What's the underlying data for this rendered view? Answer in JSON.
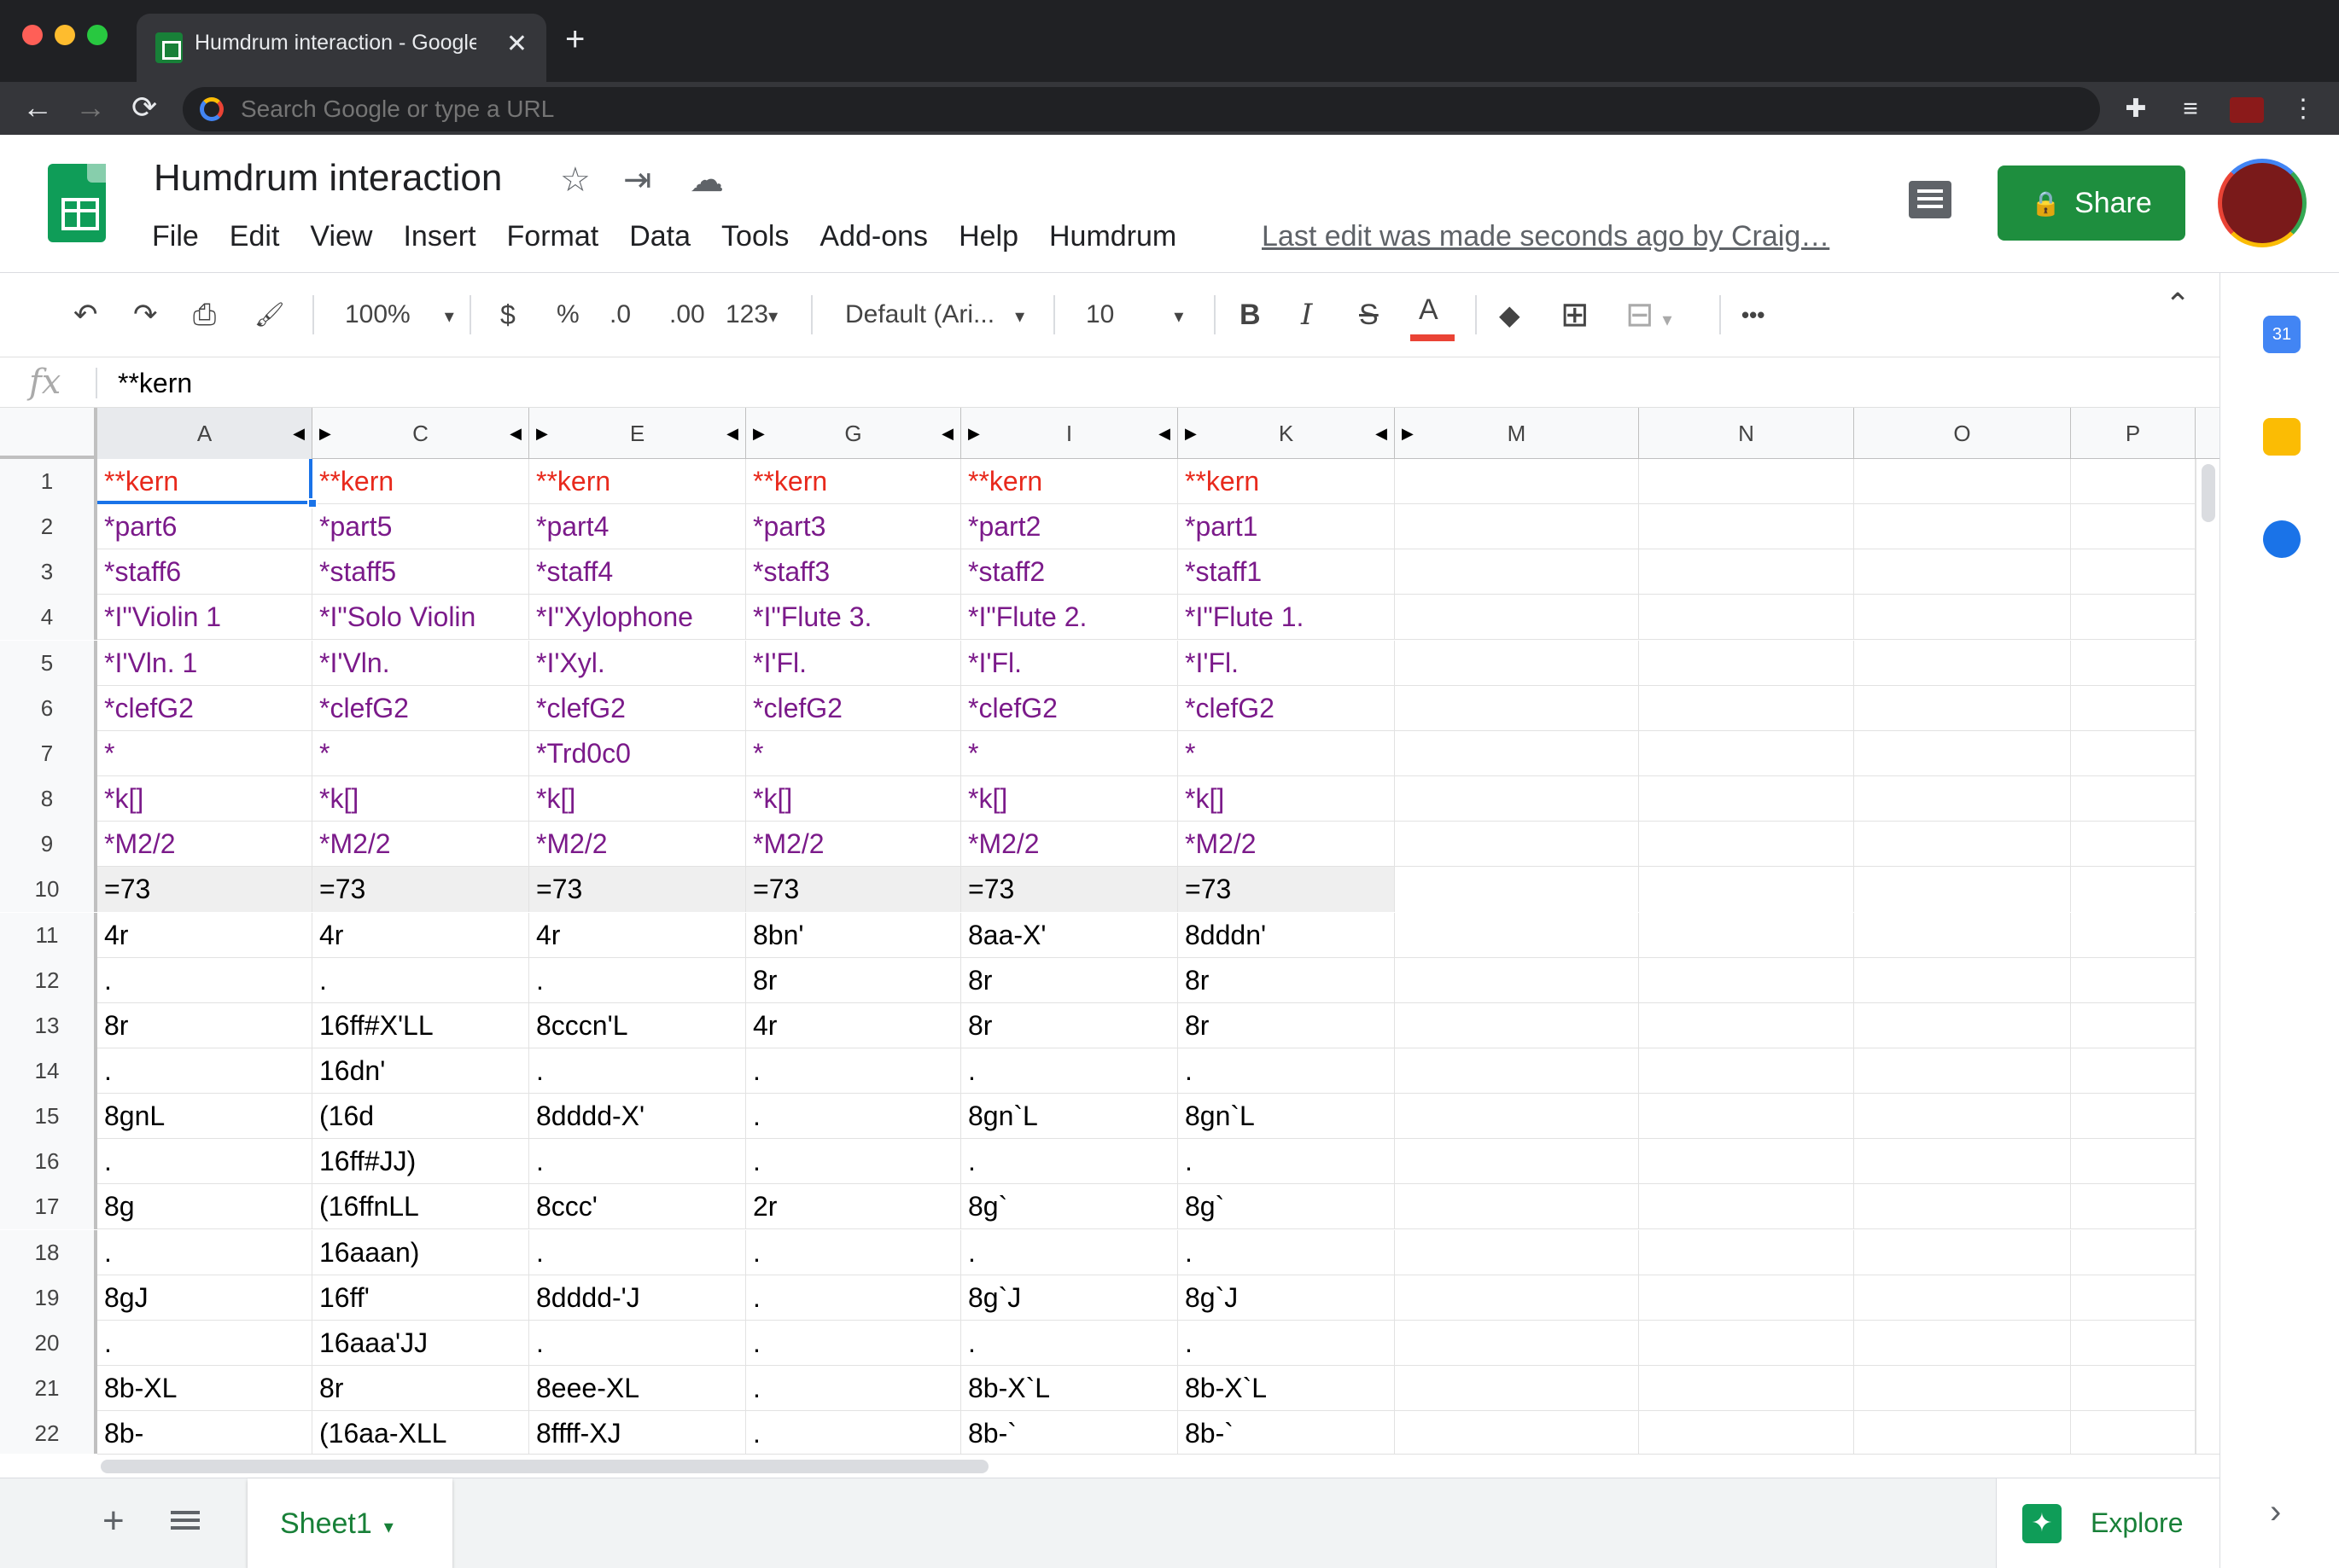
{
  "browser": {
    "tab_title": "Humdrum interaction - Google",
    "tab_close": "✕",
    "new_tab": "+",
    "back": "←",
    "forward": "→",
    "reload": "⟳",
    "omnibox_placeholder": "Search Google or type a URL",
    "menu": "⋮"
  },
  "app": {
    "title": "Humdrum interaction",
    "menus": [
      "File",
      "Edit",
      "View",
      "Insert",
      "Format",
      "Data",
      "Tools",
      "Add-ons",
      "Help",
      "Humdrum"
    ],
    "last_edit": "Last edit was made seconds ago by Craig…",
    "share_label": "Share",
    "star": "☆",
    "move": "⇥",
    "cloud": "☁"
  },
  "toolbar": {
    "undo": "↶",
    "redo": "↷",
    "print": "⎙",
    "paint": "🖌",
    "zoom": "100%",
    "currency": "$",
    "percent": "%",
    "dec_decrease": ".0",
    "dec_increase": ".00",
    "more_formats": "123",
    "font": "Default (Ari...",
    "font_size": "10",
    "bold": "B",
    "italic": "I",
    "strike": "S",
    "text_color": "A",
    "fill": "◆",
    "borders": "⊞",
    "merge": "⊟",
    "more": "•••",
    "collapse": "⌃",
    "caret": "▾"
  },
  "formula": {
    "fx": "fx",
    "value": "**kern"
  },
  "columns": [
    "A",
    "C",
    "E",
    "G",
    "I",
    "K",
    "M",
    "N",
    "O",
    "P"
  ],
  "rows": [
    {
      "n": "1",
      "style": "red",
      "cells": [
        "**kern",
        "**kern",
        "**kern",
        "**kern",
        "**kern",
        "**kern"
      ]
    },
    {
      "n": "2",
      "style": "purple",
      "cells": [
        "*part6",
        "*part5",
        "*part4",
        "*part3",
        "*part2",
        "*part1"
      ]
    },
    {
      "n": "3",
      "style": "purple",
      "cells": [
        "*staff6",
        "*staff5",
        "*staff4",
        "*staff3",
        "*staff2",
        "*staff1"
      ]
    },
    {
      "n": "4",
      "style": "purple",
      "cells": [
        "*I\"Violin 1",
        "*I\"Solo Violin",
        "*I\"Xylophone",
        "*I\"Flute 3.",
        "*I\"Flute 2.",
        "*I\"Flute 1."
      ]
    },
    {
      "n": "5",
      "style": "purple",
      "cells": [
        "*I'Vln. 1",
        "*I'Vln.",
        "*I'Xyl.",
        "*I'Fl.",
        "*I'Fl.",
        "*I'Fl."
      ]
    },
    {
      "n": "6",
      "style": "purple",
      "cells": [
        "*clefG2",
        "*clefG2",
        "*clefG2",
        "*clefG2",
        "*clefG2",
        "*clefG2"
      ]
    },
    {
      "n": "7",
      "style": "purple",
      "cells": [
        "*",
        "*",
        "*Trd0c0",
        "*",
        "*",
        "*"
      ]
    },
    {
      "n": "8",
      "style": "purple",
      "cells": [
        "*k[]",
        "*k[]",
        "*k[]",
        "*k[]",
        "*k[]",
        "*k[]"
      ]
    },
    {
      "n": "9",
      "style": "purple",
      "cells": [
        "*M2/2",
        "*M2/2",
        "*M2/2",
        "*M2/2",
        "*M2/2",
        "*M2/2"
      ]
    },
    {
      "n": "10",
      "style": "grey",
      "cells": [
        "=73",
        "=73",
        "=73",
        "=73",
        "=73",
        "=73"
      ]
    },
    {
      "n": "11",
      "style": "",
      "cells": [
        "4r",
        "4r",
        "4r",
        "8bn'",
        "8aa-X'",
        "8dddn'"
      ]
    },
    {
      "n": "12",
      "style": "",
      "cells": [
        ".",
        ".",
        ".",
        "8r",
        "8r",
        "8r"
      ]
    },
    {
      "n": "13",
      "style": "",
      "cells": [
        "8r",
        "16ff#X'LL",
        "8cccn'L",
        "4r",
        "8r",
        "8r"
      ]
    },
    {
      "n": "14",
      "style": "",
      "cells": [
        ".",
        "16dn'",
        ".",
        ".",
        ".",
        "."
      ]
    },
    {
      "n": "15",
      "style": "",
      "cells": [
        "8gnL",
        "(16d",
        "8dddd-X'",
        ".",
        "8gn`L",
        "8gn`L"
      ]
    },
    {
      "n": "16",
      "style": "",
      "cells": [
        ".",
        "16ff#JJ)",
        ".",
        ".",
        ".",
        "."
      ]
    },
    {
      "n": "17",
      "style": "",
      "cells": [
        "8g",
        "(16ffnLL",
        "8ccc'",
        "2r",
        "8g`",
        "8g`"
      ]
    },
    {
      "n": "18",
      "style": "",
      "cells": [
        ".",
        "16aaan)",
        ".",
        ".",
        ".",
        "."
      ]
    },
    {
      "n": "19",
      "style": "",
      "cells": [
        "8gJ",
        "16ff'",
        "8dddd-'J",
        ".",
        "8g`J",
        "8g`J"
      ]
    },
    {
      "n": "20",
      "style": "",
      "cells": [
        ".",
        "16aaa'JJ",
        ".",
        ".",
        ".",
        "."
      ]
    },
    {
      "n": "21",
      "style": "",
      "cells": [
        "8b-XL",
        "8r",
        "8eee-XL",
        ".",
        "8b-X`L",
        "8b-X`L"
      ]
    },
    {
      "n": "22",
      "style": "",
      "cells": [
        "8b-",
        "(16aa-XLL",
        "8ffff-XJ",
        ".",
        "8b-`",
        "8b-`"
      ]
    }
  ],
  "sheets": {
    "add": "+",
    "active": "Sheet1",
    "caret": "▾",
    "explore": "Explore"
  },
  "side_panel": {
    "calendar": "31",
    "expand": "›"
  },
  "colors": {
    "kern_red": "#e8291c",
    "interp_purple": "#7b1a8a",
    "share_green": "#1e8e3e",
    "selection_blue": "#1a73e8"
  }
}
